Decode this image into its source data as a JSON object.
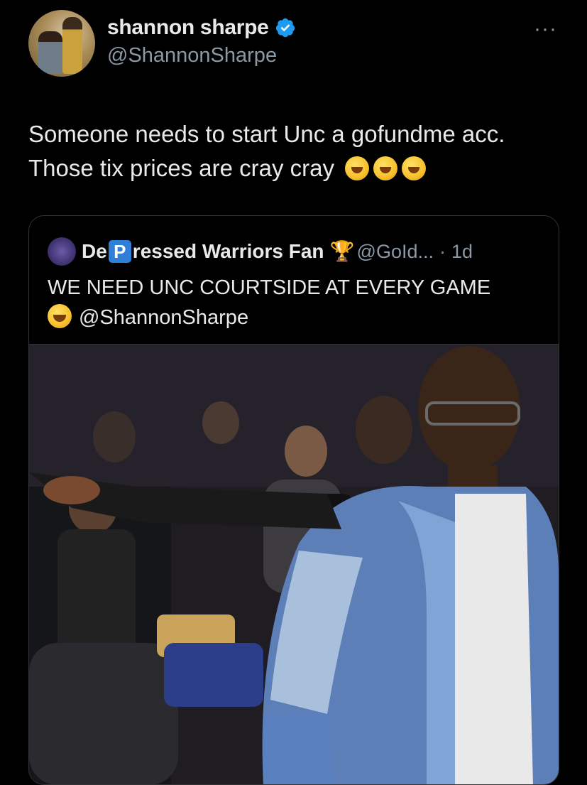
{
  "author": {
    "display_name": "shannon sharpe",
    "handle": "@ShannonSharpe",
    "verified": true
  },
  "menu": {
    "more_label": "···"
  },
  "tweet": {
    "text_line1": "Someone needs to start Unc a gofundme acc.",
    "text_line2": "Those tix prices are cray cray",
    "emoji": "rolling-on-the-floor-laughing",
    "emoji_count": 3
  },
  "quoted_tweet": {
    "name_prefix": "De",
    "name_badge": "P",
    "name_suffix": "ressed Warriors Fan",
    "name_emoji": "trophy",
    "handle": "@GoId...",
    "separator": "·",
    "timestamp": "1d",
    "text": "WE NEED UNC COURTSIDE AT EVERY GAME",
    "mention_emoji": "face-with-tears-of-joy",
    "mention": "@ShannonSharpe"
  },
  "colors": {
    "background": "#000000",
    "text_primary": "#e7e9ea",
    "text_secondary": "#8b98a5",
    "verified_blue": "#1d9bf0",
    "border": "#333333"
  }
}
